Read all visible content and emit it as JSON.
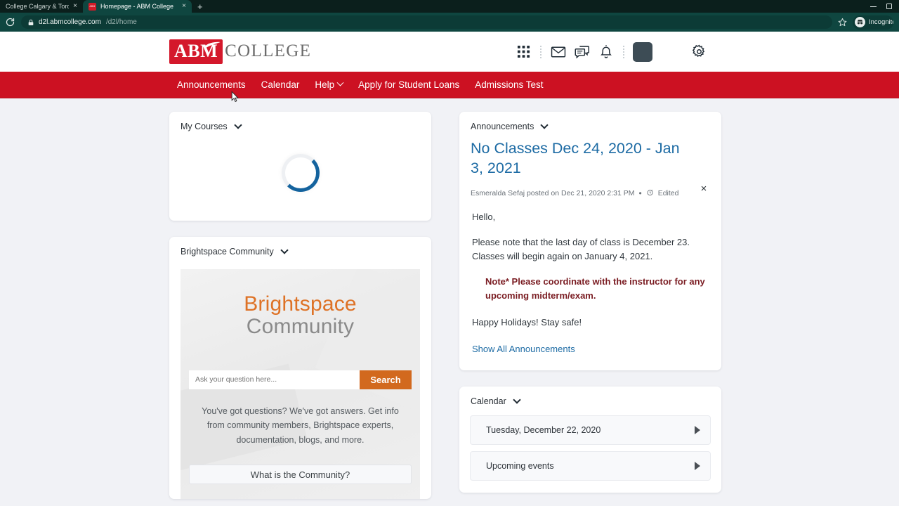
{
  "browser": {
    "tabs": [
      {
        "title": "College Calgary & Toronto",
        "active": false,
        "favicon": "none"
      },
      {
        "title": "Homepage - ABM College",
        "active": true,
        "favicon": "abm-favicon"
      }
    ],
    "new_tab_label": "+",
    "reload_icon": "reload-icon",
    "lock_icon": "lock-icon",
    "url_host": "d2l.abmcollege.com",
    "url_path": "/d2l/home",
    "star_icon": "star-icon",
    "profile_chip": "Incognito",
    "window_minimize": "minimize-icon",
    "window_maximize": "maximize-icon"
  },
  "header": {
    "logo_badge": "ABM",
    "logo_word": "COLLEGE",
    "icons": [
      {
        "name": "waffle-grid-icon",
        "label": "Course selector"
      },
      {
        "name": "envelope-icon",
        "label": "Email"
      },
      {
        "name": "chat-icon",
        "label": "Messages"
      },
      {
        "name": "bell-icon",
        "label": "Notifications"
      },
      {
        "name": "avatar",
        "label": "Profile"
      },
      {
        "name": "gear-icon",
        "label": "Settings"
      }
    ]
  },
  "nav": {
    "items": [
      {
        "label": "Announcements",
        "has_caret": false
      },
      {
        "label": "Calendar",
        "has_caret": false
      },
      {
        "label": "Help",
        "has_caret": true
      },
      {
        "label": "Apply for Student Loans",
        "has_caret": false
      },
      {
        "label": "Admissions Test",
        "has_caret": false
      }
    ],
    "background": "#cc1122"
  },
  "my_courses": {
    "title": "My Courses",
    "state": "loading"
  },
  "brightspace_community": {
    "title": "Brightspace Community",
    "logo_line1": "Brightspace",
    "logo_line2": "Community",
    "search_placeholder": "Ask your question here...",
    "search_button": "Search",
    "search_value": "",
    "copy": "You've got questions? We've got answers. Get info from community members, Brightspace experts, documentation, blogs, and more.",
    "cta": "What is the Community?",
    "accent": "#d2691e"
  },
  "announcements": {
    "title": "Announcements",
    "item_title": "No Classes Dec 24, 2020 - Jan 3, 2021",
    "meta_author_date": "Esmeralda Sefaj posted on Dec 21, 2020 2:31 PM",
    "meta_separator": "•",
    "meta_edited": "Edited",
    "close_label": "×",
    "paragraphs": [
      "Hello,",
      "Please note that the last day of class is December 23. Classes will begin again on January 4, 2021."
    ],
    "note": "Note* Please coordinate with the instructor for any upcoming midterm/exam.",
    "closing": "Happy Holidays! Stay safe!",
    "show_all_link": "Show All Announcements",
    "link_color": "#1d6ba4",
    "note_color": "#7a1c22"
  },
  "calendar": {
    "title": "Calendar",
    "rows": [
      {
        "label": "Tuesday, December 22, 2020"
      },
      {
        "label": "Upcoming events"
      }
    ]
  }
}
